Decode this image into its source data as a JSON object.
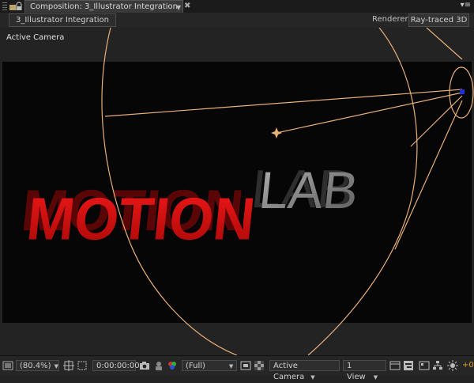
{
  "tabbar": {
    "comp_tab_label": "Composition: 3_Illustrator Integration",
    "close_glyph": "✖",
    "panel_menu_glyph": "▾≡"
  },
  "toolbar": {
    "comp_name": "3_Illustrator Integration",
    "renderer_label": "Renderer:",
    "renderer_value": "Ray-traced 3D"
  },
  "viewer": {
    "active_camera_label": "Active Camera",
    "logo_text_red": "MOTION",
    "logo_text_gray": "LAB"
  },
  "bottombar": {
    "zoom": "(80.4%)",
    "timecode": "0:00:00:00",
    "resolution": "(Full)",
    "view_camera": "Active Camera",
    "view_layout": "1 View",
    "exposure": "+0"
  },
  "colors": {
    "logo_red": "#cc1010",
    "logo_gray": "#8c8c8c",
    "camera_wire": "#e8b07a"
  }
}
